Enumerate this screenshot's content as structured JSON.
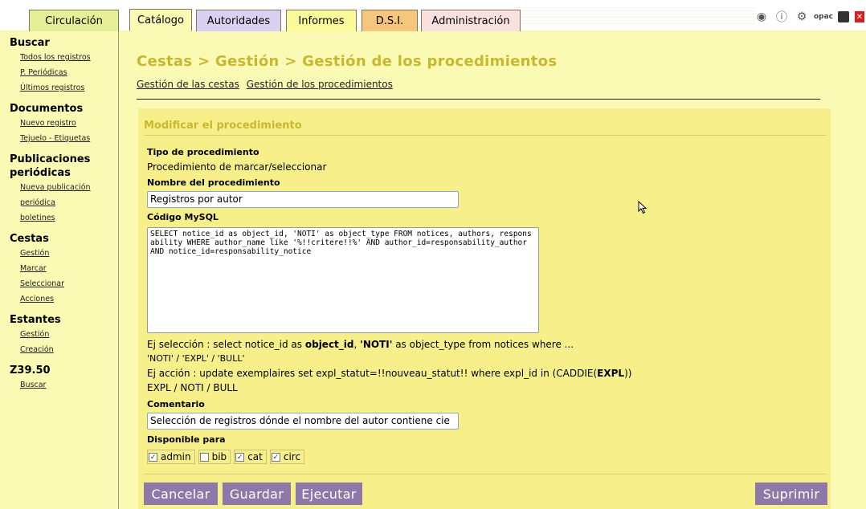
{
  "tabs": {
    "circulacion": "Circulación",
    "catalogo": "Catálogo",
    "autoridades": "Autoridades",
    "informes": "Informes",
    "dsi": "D.S.I.",
    "administracion": "Administración"
  },
  "toolbar_icons": [
    "globe-icon",
    "help-icon",
    "gear-icon",
    "opac-icon",
    "save-icon",
    "exit-icon"
  ],
  "toolbar": {
    "opac_label": "opac"
  },
  "sidebar": {
    "buscar": {
      "title": "Buscar",
      "items": [
        "Todos los registros",
        "P. Periódicas",
        "Últimos registros"
      ]
    },
    "documentos": {
      "title": "Documentos",
      "items": [
        "Nuevo registro",
        "Tejuelo - Etiquetas"
      ]
    },
    "publicaciones": {
      "title_line1": "Publicaciones",
      "title_line2": "periódicas",
      "items": [
        "Nueva publicación",
        "periódica",
        "boletines"
      ]
    },
    "cestas": {
      "title": "Cestas",
      "items": [
        "Gestión",
        "Marcar",
        "Seleccionar",
        "Acciones"
      ]
    },
    "estantes": {
      "title": "Estantes",
      "items": [
        "Gestión",
        "Creación"
      ]
    },
    "z3950": {
      "title": "Z39.50",
      "items": [
        "Buscar"
      ]
    }
  },
  "main": {
    "title": "Cestas > Gestión > Gestión de los procedimientos",
    "links": [
      "Gestión de las cestas",
      "Gestión de los procedimientos"
    ]
  },
  "form": {
    "title": "Modificar el procedimiento",
    "tipo_label": "Tipo de procedimiento",
    "tipo_value": "Procedimiento de marcar/seleccionar",
    "nombre_label": "Nombre del procedimiento",
    "nombre_value": "Registros por autor",
    "sql_label": "Código MySQL",
    "sql_value": "SELECT notice_id as object_id, 'NOTI' as object_type FROM notices, authors, responsability WHERE author_name like '%!!critere!!%' AND author_id=responsability_author AND notice_id=responsability_notice",
    "help1_pre": "Ej selección : select notice_id as ",
    "help1_b1": "object_id",
    "help1_sep": ", ",
    "help1_b2": "'NOTI'",
    "help1_post": " as object_type from notices where ...",
    "help2": "'NOTI' / 'EXPL' / 'BULL'",
    "help3_pre": "Ej acción : update exemplaires set expl_statut=!!nouveau_statut!! where expl_id in (CADDIE(",
    "help3_b": "EXPL",
    "help3_post": "))",
    "help4": "EXPL / NOTI / BULL",
    "comentario_label": "Comentario",
    "comentario_value": "Selección de registros dónde el nombre del autor contiene cie",
    "disponible_label": "Disponible para",
    "checkboxes": [
      {
        "label": "admin",
        "checked": true
      },
      {
        "label": "bib",
        "checked": false
      },
      {
        "label": "cat",
        "checked": true
      },
      {
        "label": "circ",
        "checked": true
      }
    ],
    "buttons": {
      "cancelar": "Cancelar",
      "guardar": "Guardar",
      "ejecutar": "Ejecutar",
      "suprimir": "Suprimir"
    }
  },
  "colors": {
    "background": "#fafab4",
    "panel": "#f7f08a",
    "title": "#c8b830",
    "button": "#8e78a8"
  }
}
